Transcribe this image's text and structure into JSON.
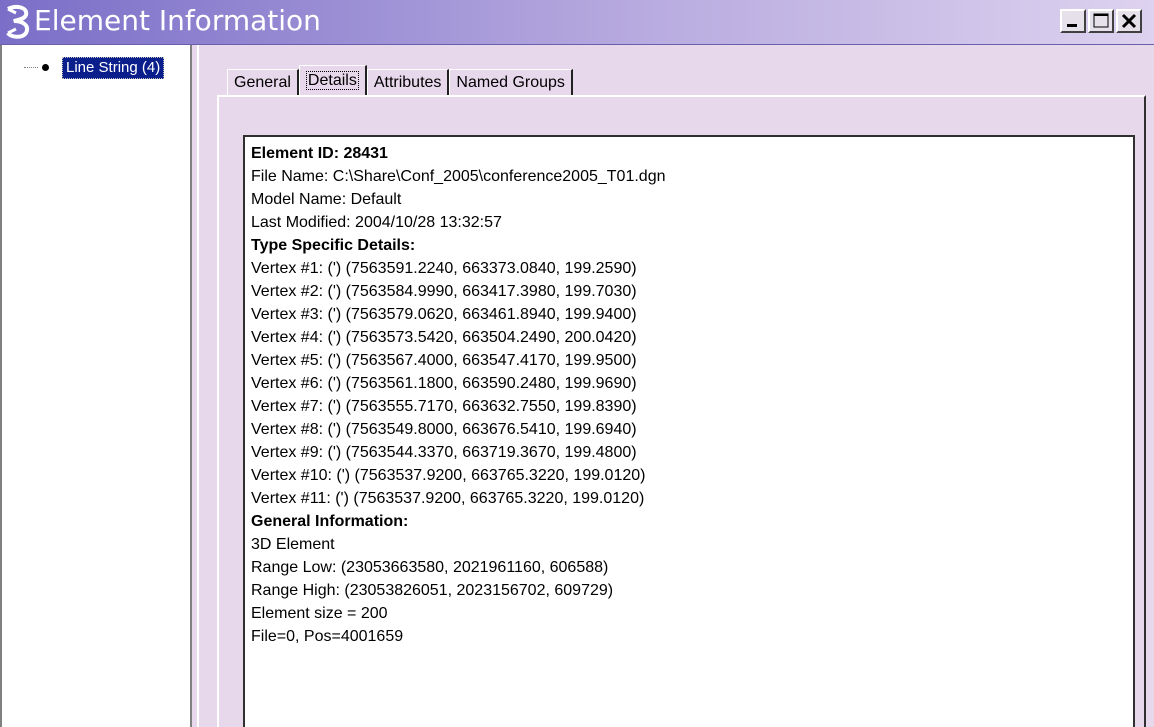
{
  "window": {
    "title": "Element Information",
    "controls": [
      "minimize",
      "maximize",
      "close"
    ],
    "accent_color": "#7a6ec8"
  },
  "tree": {
    "items": [
      {
        "label": "Line String (4)",
        "selected": true,
        "icon": "bullet-icon"
      }
    ]
  },
  "tabs": [
    {
      "label": "General",
      "active": false
    },
    {
      "label": "Details",
      "active": true
    },
    {
      "label": "Attributes",
      "active": false
    },
    {
      "label": "Named Groups",
      "active": false
    }
  ],
  "details": {
    "lines": [
      {
        "text": "Element ID: 28431",
        "bold": true
      },
      {
        "text": "File Name: C:\\Share\\Conf_2005\\conference2005_T01.dgn",
        "bold": false
      },
      {
        "text": "Model Name: Default",
        "bold": false
      },
      {
        "text": "Last Modified: 2004/10/28 13:32:57",
        "bold": false
      },
      {
        "text": "Type Specific Details:",
        "bold": true
      },
      {
        "text": "Vertex #1:  (') (7563591.2240, 663373.0840, 199.2590)",
        "bold": false
      },
      {
        "text": "Vertex #2:  (') (7563584.9990, 663417.3980, 199.7030)",
        "bold": false
      },
      {
        "text": "Vertex #3:  (') (7563579.0620, 663461.8940, 199.9400)",
        "bold": false
      },
      {
        "text": "Vertex #4:  (') (7563573.5420, 663504.2490, 200.0420)",
        "bold": false
      },
      {
        "text": "Vertex #5:  (') (7563567.4000, 663547.4170, 199.9500)",
        "bold": false
      },
      {
        "text": "Vertex #6:  (') (7563561.1800, 663590.2480, 199.9690)",
        "bold": false
      },
      {
        "text": "Vertex #7:  (') (7563555.7170, 663632.7550, 199.8390)",
        "bold": false
      },
      {
        "text": "Vertex #8:  (') (7563549.8000, 663676.5410, 199.6940)",
        "bold": false
      },
      {
        "text": "Vertex #9:  (') (7563544.3370, 663719.3670, 199.4800)",
        "bold": false
      },
      {
        "text": "Vertex #10:  (') (7563537.9200, 663765.3220, 199.0120)",
        "bold": false
      },
      {
        "text": "Vertex #11:  (') (7563537.9200, 663765.3220, 199.0120)",
        "bold": false
      },
      {
        "text": "General Information:",
        "bold": true
      },
      {
        "text": "3D Element",
        "bold": false
      },
      {
        "text": "Range Low: (23053663580, 2021961160, 606588)",
        "bold": false
      },
      {
        "text": "Range High: (23053826051, 2023156702, 609729)",
        "bold": false
      },
      {
        "text": "Element size = 200",
        "bold": false
      },
      {
        "text": "File=0, Pos=4001659",
        "bold": false
      }
    ]
  }
}
